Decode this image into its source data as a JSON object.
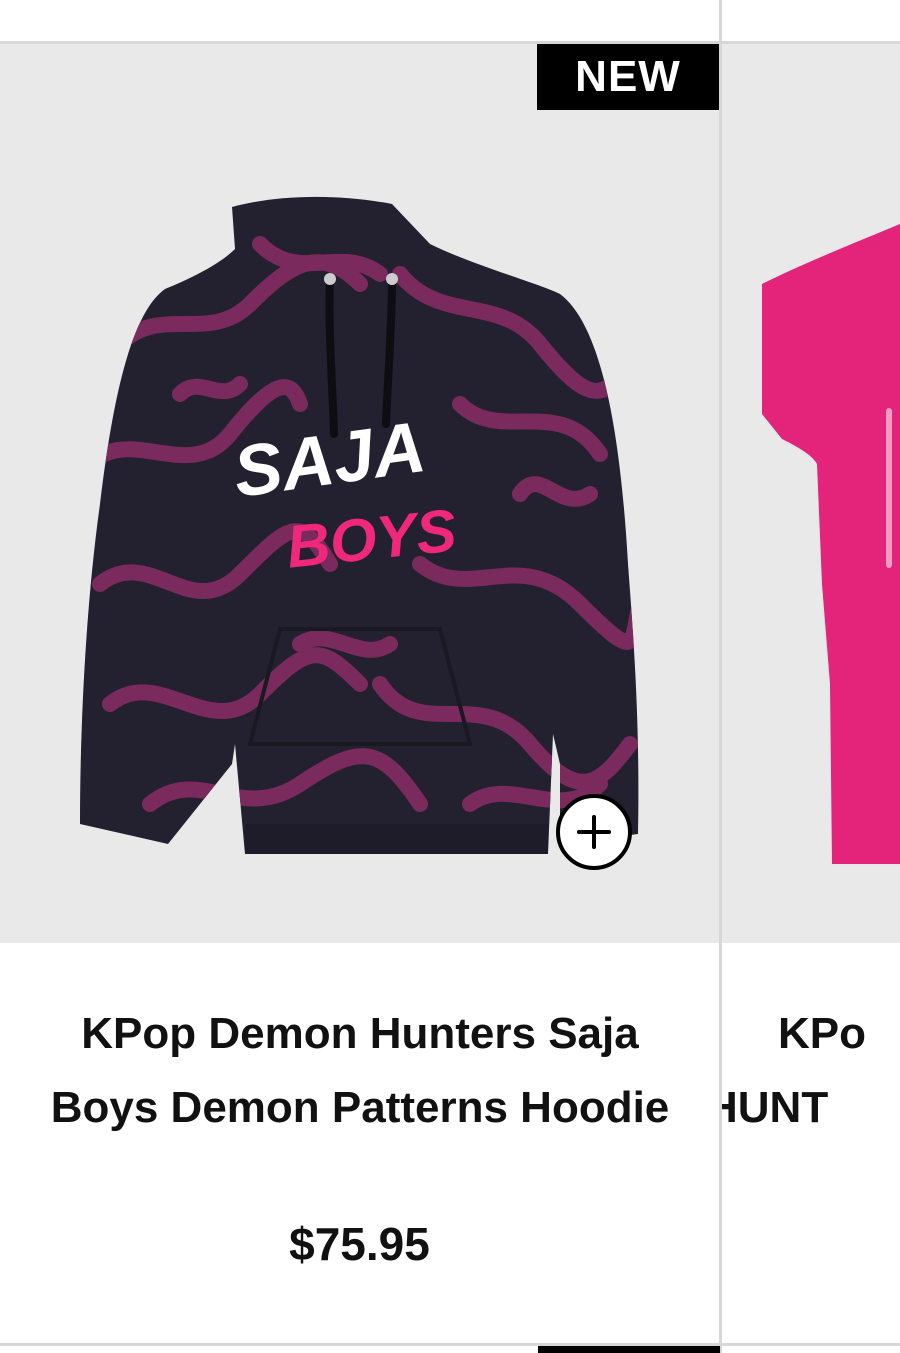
{
  "products": [
    {
      "badge": "NEW",
      "title": "KPop Demon Hunters Saja Boys Demon Patterns Hoodie",
      "price": "$75.95",
      "image": {
        "alt": "Saja Boys hoodie",
        "print_line1": "SAJA",
        "print_line2": "BOYS",
        "body_color": "#232030",
        "pattern_color": "#7a2a5c",
        "accent_color": "#f0287c"
      },
      "quick_add_icon": "plus-icon"
    },
    {
      "title_partial_line1": "KPo",
      "title_partial_line2": "HUNT",
      "image": {
        "alt": "pink t-shirt",
        "body_color": "#e4247a"
      }
    }
  ],
  "colors": {
    "card_background": "#e9e9ea",
    "divider": "#d7d7d7",
    "badge_background": "#000000",
    "text": "#111111"
  }
}
